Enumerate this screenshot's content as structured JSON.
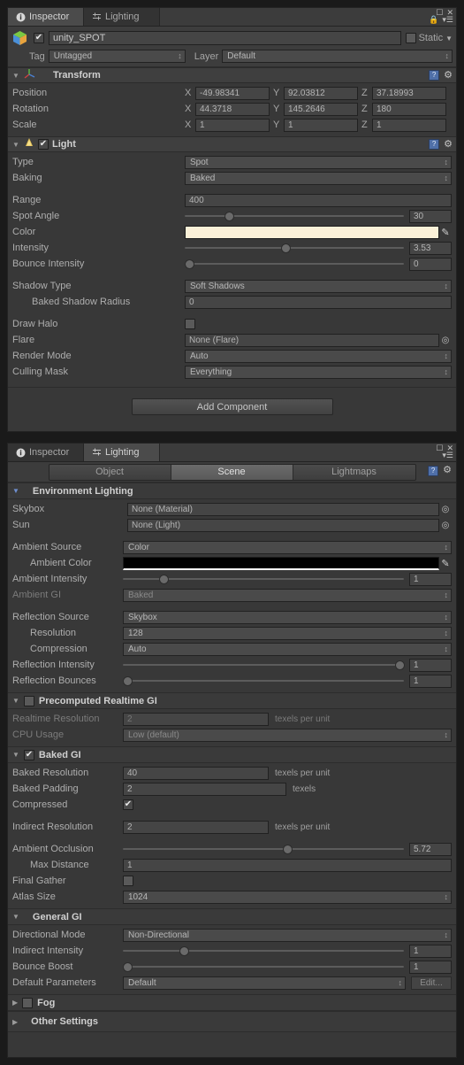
{
  "inspector": {
    "tabs": [
      {
        "label": "Inspector",
        "icon": "info-icon",
        "active": true
      },
      {
        "label": "Lighting",
        "icon": "lighting-icon",
        "active": false
      }
    ],
    "window_controls": [
      "maximize-icon",
      "close-icon",
      "dropdown-menu-icon"
    ],
    "object": {
      "enabled_checkbox": "✔",
      "name": "unity_SPOT",
      "static_label": "Static",
      "static_checked": false,
      "tag_label": "Tag",
      "tag_value": "Untagged",
      "layer_label": "Layer",
      "layer_value": "Default"
    },
    "transform": {
      "title": "Transform",
      "rows": [
        {
          "label": "Position",
          "x": "-49.98341",
          "y": "92.03812",
          "z": "37.18993"
        },
        {
          "label": "Rotation",
          "x": "44.3718",
          "y": "145.2646",
          "z": "180"
        },
        {
          "label": "Scale",
          "x": "1",
          "y": "1",
          "z": "1"
        }
      ],
      "axes": [
        "X",
        "Y",
        "Z"
      ]
    },
    "light": {
      "title": "Light",
      "enabled": true,
      "type_label": "Type",
      "type_value": "Spot",
      "baking_label": "Baking",
      "baking_value": "Baked",
      "range_label": "Range",
      "range_value": "400",
      "spot_angle_label": "Spot Angle",
      "spot_angle_value": "30",
      "spot_angle_pct": 18,
      "color_label": "Color",
      "color_value": "#FAF0D7",
      "intensity_label": "Intensity",
      "intensity_value": "3.53",
      "intensity_pct": 44,
      "bounce_label": "Bounce Intensity",
      "bounce_value": "0",
      "bounce_pct": 1,
      "shadow_type_label": "Shadow Type",
      "shadow_type_value": "Soft Shadows",
      "baked_shadow_radius_label": "Baked Shadow Radius",
      "baked_shadow_radius_value": "0",
      "draw_halo_label": "Draw Halo",
      "draw_halo_checked": false,
      "flare_label": "Flare",
      "flare_value": "None (Flare)",
      "render_mode_label": "Render Mode",
      "render_mode_value": "Auto",
      "culling_mask_label": "Culling Mask",
      "culling_mask_value": "Everything"
    },
    "add_component_label": "Add Component"
  },
  "lighting": {
    "tabs": [
      {
        "label": "Inspector",
        "icon": "info-icon",
        "active": false
      },
      {
        "label": "Lighting",
        "icon": "lighting-icon",
        "active": true
      }
    ],
    "window_controls": [
      "maximize-icon",
      "close-icon",
      "dropdown-menu-icon"
    ],
    "toolbar_tabs": [
      {
        "label": "Object",
        "active": false
      },
      {
        "label": "Scene",
        "active": true
      },
      {
        "label": "Lightmaps",
        "active": false
      }
    ],
    "environment": {
      "title": "Environment Lighting",
      "skybox_label": "Skybox",
      "skybox_value": "None (Material)",
      "sun_label": "Sun",
      "sun_value": "None (Light)",
      "ambient_source_label": "Ambient Source",
      "ambient_source_value": "Color",
      "ambient_color_label": "Ambient Color",
      "ambient_color_value": "#000000",
      "ambient_intensity_label": "Ambient Intensity",
      "ambient_intensity_value": "1",
      "ambient_intensity_pct": 13,
      "ambient_gi_label": "Ambient GI",
      "ambient_gi_value": "Baked",
      "reflection_source_label": "Reflection Source",
      "reflection_source_value": "Skybox",
      "resolution_label": "Resolution",
      "resolution_value": "128",
      "compression_label": "Compression",
      "compression_value": "Auto",
      "reflection_intensity_label": "Reflection Intensity",
      "reflection_intensity_value": "1",
      "reflection_intensity_pct": 97,
      "reflection_bounces_label": "Reflection Bounces",
      "reflection_bounces_value": "1",
      "reflection_bounces_pct": 1
    },
    "precomputed_gi": {
      "title": "Precomputed Realtime GI",
      "enabled": false,
      "realtime_resolution_label": "Realtime Resolution",
      "realtime_resolution_value": "2",
      "realtime_resolution_unit": "texels per unit",
      "cpu_usage_label": "CPU Usage",
      "cpu_usage_value": "Low (default)"
    },
    "baked_gi": {
      "title": "Baked GI",
      "enabled": true,
      "baked_resolution_label": "Baked Resolution",
      "baked_resolution_value": "40",
      "baked_resolution_unit": "texels per unit",
      "baked_padding_label": "Baked Padding",
      "baked_padding_value": "2",
      "baked_padding_unit": "texels",
      "compressed_label": "Compressed",
      "compressed_checked": true,
      "indirect_resolution_label": "Indirect Resolution",
      "indirect_resolution_value": "2",
      "indirect_resolution_unit": "texels per unit",
      "ambient_occlusion_label": "Ambient Occlusion",
      "ambient_occlusion_value": "5.72",
      "ambient_occlusion_pct": 57,
      "max_distance_label": "Max Distance",
      "max_distance_value": "1",
      "final_gather_label": "Final Gather",
      "final_gather_checked": false,
      "atlas_size_label": "Atlas Size",
      "atlas_size_value": "1024"
    },
    "general_gi": {
      "title": "General GI",
      "directional_mode_label": "Directional Mode",
      "directional_mode_value": "Non-Directional",
      "indirect_intensity_label": "Indirect Intensity",
      "indirect_intensity_value": "1",
      "indirect_intensity_pct": 20,
      "bounce_boost_label": "Bounce Boost",
      "bounce_boost_value": "1",
      "bounce_boost_pct": 1,
      "default_parameters_label": "Default Parameters",
      "default_parameters_value": "Default",
      "edit_button_label": "Edit..."
    },
    "fog": {
      "title": "Fog",
      "enabled": false
    },
    "other_settings": {
      "title": "Other Settings"
    }
  }
}
